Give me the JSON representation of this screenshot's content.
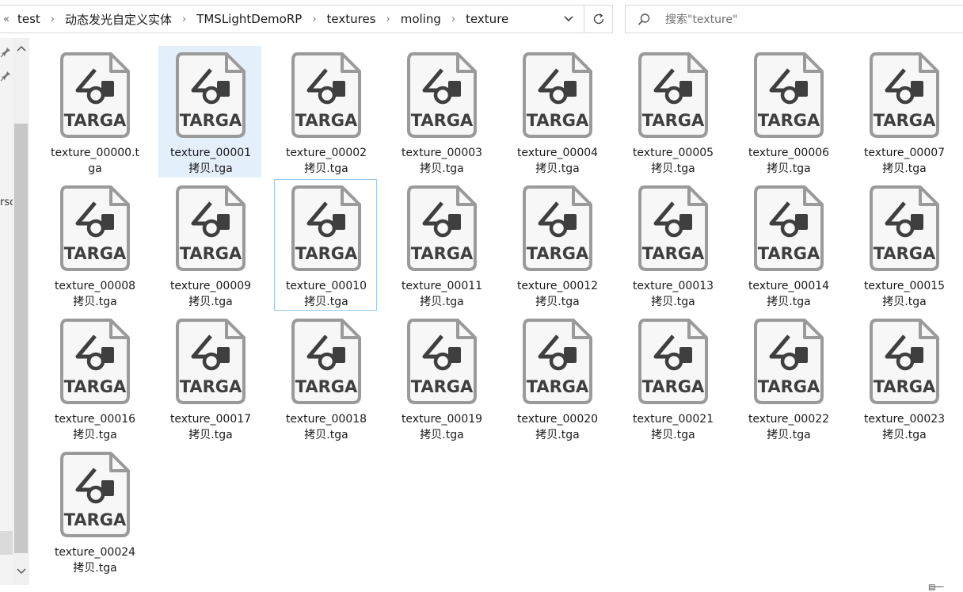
{
  "breadcrumb": {
    "overflow": "«",
    "segments": [
      "test",
      "动态发光自定义实体",
      "TMSLightDemoRP",
      "textures",
      "moling",
      "texture"
    ]
  },
  "search": {
    "placeholder": "搜索\"texture\""
  },
  "nav": {
    "partial_label": "rsc"
  },
  "file_type_badge": "TARGA",
  "files": [
    {
      "line1": "texture_00000.t",
      "line2": "ga",
      "state": ""
    },
    {
      "line1": "texture_00001",
      "line2": "拷贝.tga",
      "state": "selected"
    },
    {
      "line1": "texture_00002",
      "line2": "拷贝.tga",
      "state": ""
    },
    {
      "line1": "texture_00003",
      "line2": "拷贝.tga",
      "state": ""
    },
    {
      "line1": "texture_00004",
      "line2": "拷贝.tga",
      "state": ""
    },
    {
      "line1": "texture_00005",
      "line2": "拷贝.tga",
      "state": ""
    },
    {
      "line1": "texture_00006",
      "line2": "拷贝.tga",
      "state": ""
    },
    {
      "line1": "texture_00007",
      "line2": "拷贝.tga",
      "state": ""
    },
    {
      "line1": "texture_00008",
      "line2": "拷贝.tga",
      "state": ""
    },
    {
      "line1": "texture_00009",
      "line2": "拷贝.tga",
      "state": ""
    },
    {
      "line1": "texture_00010",
      "line2": "拷贝.tga",
      "state": "focused"
    },
    {
      "line1": "texture_00011",
      "line2": "拷贝.tga",
      "state": ""
    },
    {
      "line1": "texture_00012",
      "line2": "拷贝.tga",
      "state": ""
    },
    {
      "line1": "texture_00013",
      "line2": "拷贝.tga",
      "state": ""
    },
    {
      "line1": "texture_00014",
      "line2": "拷贝.tga",
      "state": ""
    },
    {
      "line1": "texture_00015",
      "line2": "拷贝.tga",
      "state": ""
    },
    {
      "line1": "texture_00016",
      "line2": "拷贝.tga",
      "state": ""
    },
    {
      "line1": "texture_00017",
      "line2": "拷贝.tga",
      "state": ""
    },
    {
      "line1": "texture_00018",
      "line2": "拷贝.tga",
      "state": ""
    },
    {
      "line1": "texture_00019",
      "line2": "拷贝.tga",
      "state": ""
    },
    {
      "line1": "texture_00020",
      "line2": "拷贝.tga",
      "state": ""
    },
    {
      "line1": "texture_00021",
      "line2": "拷贝.tga",
      "state": ""
    },
    {
      "line1": "texture_00022",
      "line2": "拷贝.tga",
      "state": ""
    },
    {
      "line1": "texture_00023",
      "line2": "拷贝.tga",
      "state": ""
    },
    {
      "line1": "texture_00024",
      "line2": "拷贝.tga",
      "state": ""
    }
  ],
  "colors": {
    "selected_bg": "#e3effb",
    "focus_border": "#99c9ea",
    "icon_stroke": "#9a9a9a",
    "icon_glyph": "#3f3f3f"
  },
  "icons": {
    "overflow": "double-chevron-left-icon",
    "separator": "chevron-right-icon",
    "dropdown": "chevron-down-icon",
    "refresh": "refresh-icon",
    "search": "search-icon",
    "pin": "pin-icon",
    "file": "targa-file-icon"
  }
}
